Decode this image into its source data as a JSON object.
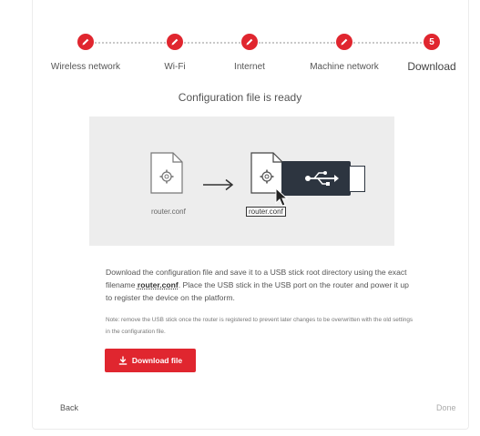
{
  "stepper": {
    "steps": [
      {
        "label": "Wireless network",
        "state": "completed",
        "icon": "pencil-icon"
      },
      {
        "label": "Wi-Fi",
        "state": "completed",
        "icon": "pencil-icon"
      },
      {
        "label": "Internet",
        "state": "completed",
        "icon": "pencil-icon"
      },
      {
        "label": "Machine network",
        "state": "completed",
        "icon": "pencil-icon"
      },
      {
        "label": "Download",
        "state": "active",
        "number": "5"
      }
    ],
    "accent_color": "#e0262f"
  },
  "main": {
    "heading": "Configuration file is ready",
    "illustration": {
      "source_file": "router.conf",
      "target_file": "router.conf",
      "usb_icon": "usb-icon",
      "arrow_icon": "arrow-right-icon"
    },
    "description_pre": "Download the configuration file and save it to a USB stick root directory using the exact filename ",
    "description_filename": "router.conf",
    "description_post": ". Place the USB stick in the USB port on the router and power it up to register the device on the platform.",
    "note": "Note: remove the USB stick once the router is registered to prevent later changes to be overwritten with the old settings in the configuration file.",
    "download_button": {
      "label": "Download file",
      "icon": "download-icon"
    }
  },
  "footer": {
    "back_label": "Back",
    "done_label": "Done"
  }
}
